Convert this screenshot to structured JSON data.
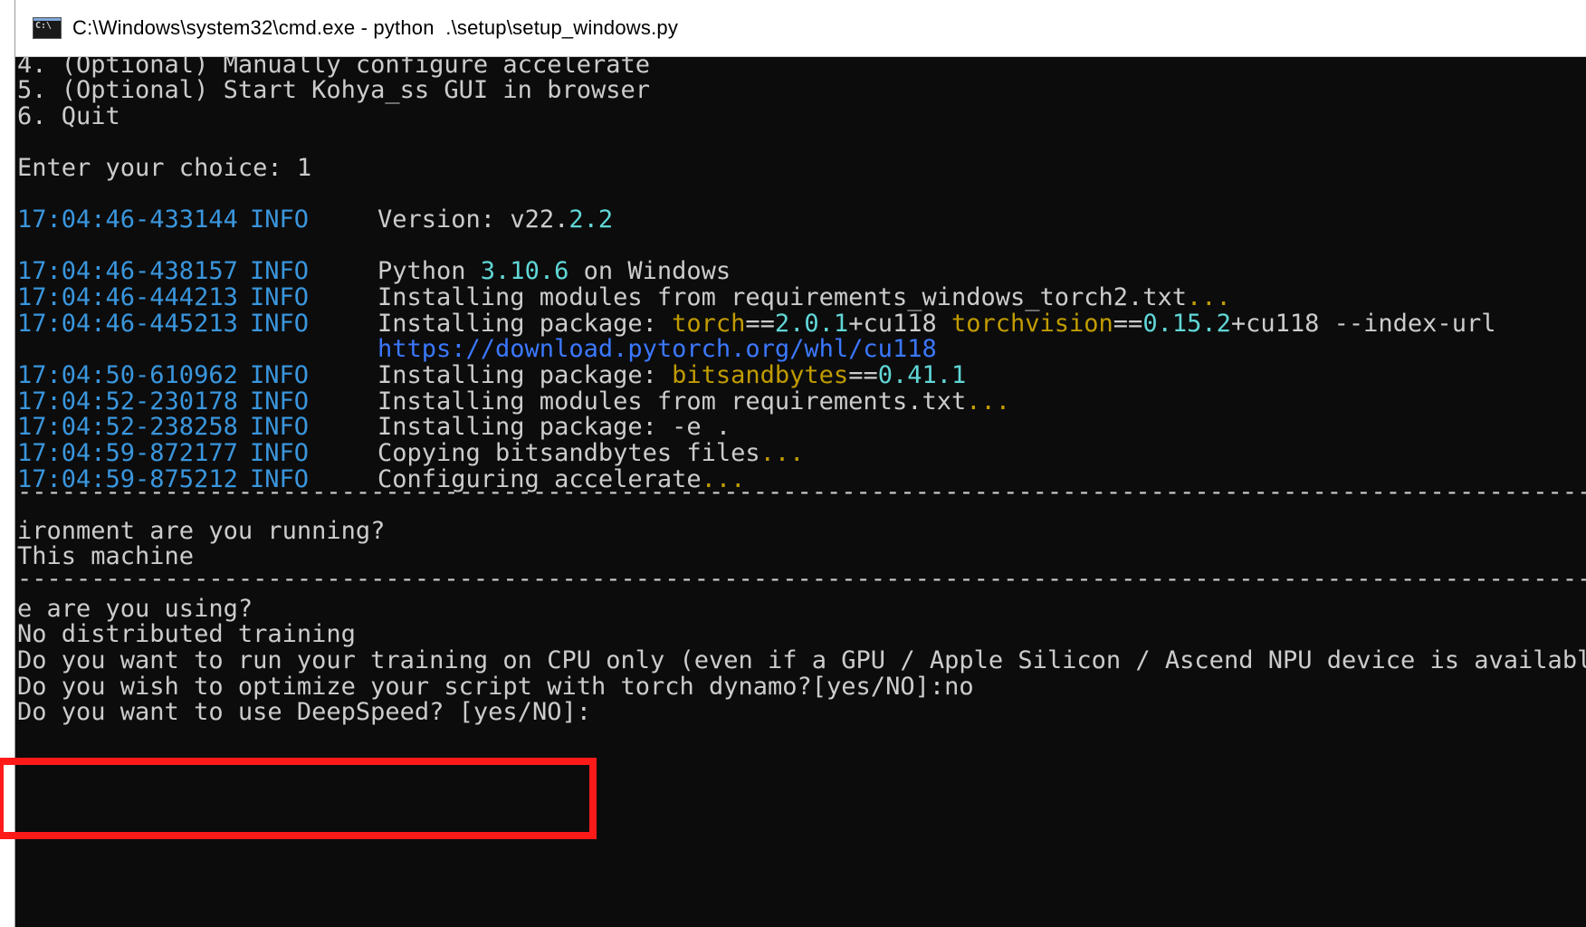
{
  "window": {
    "title": "C:\\Windows\\system32\\cmd.exe - python  .\\setup\\setup_windows.py",
    "icon": "cmd-icon"
  },
  "menu": [
    "4. (Optional) Manually configure accelerate",
    "5. (Optional) Start Kohya_ss GUI in browser",
    "6. Quit"
  ],
  "prompt": "Enter your choice: 1",
  "logs": [
    {
      "ts": "17:04:46-433144",
      "level": "INFO",
      "parts": [
        [
          "w",
          "Version: "
        ],
        [
          "w",
          "v22."
        ],
        [
          "c",
          "2.2"
        ]
      ]
    },
    {
      "ts": "17:04:46-438157",
      "level": "INFO",
      "parts": [
        [
          "w",
          "Python "
        ],
        [
          "c",
          "3.10.6"
        ],
        [
          "w",
          " on Windows"
        ]
      ]
    },
    {
      "ts": "17:04:46-444213",
      "level": "INFO",
      "parts": [
        [
          "w",
          "Installing modules from requirements_windows_torch2.txt"
        ],
        [
          "y",
          "..."
        ]
      ]
    },
    {
      "ts": "17:04:46-445213",
      "level": "INFO",
      "parts": [
        [
          "w",
          "Installing package: "
        ],
        [
          "y",
          "torch"
        ],
        [
          "w",
          "=="
        ],
        [
          "c",
          "2.0.1"
        ],
        [
          "w",
          "+cu118 "
        ],
        [
          "y",
          "torchvision"
        ],
        [
          "w",
          "=="
        ],
        [
          "c",
          "0.15.2"
        ],
        [
          "w",
          "+cu118 --index-url"
        ]
      ]
    },
    {
      "ts": "",
      "level": "",
      "parts": [
        [
          "b",
          "https://download.pytorch.org/whl/cu118"
        ]
      ]
    },
    {
      "ts": "17:04:50-610962",
      "level": "INFO",
      "parts": [
        [
          "w",
          "Installing package: "
        ],
        [
          "y",
          "bitsandbytes"
        ],
        [
          "w",
          "=="
        ],
        [
          "c",
          "0.41.1"
        ]
      ]
    },
    {
      "ts": "17:04:52-230178",
      "level": "INFO",
      "parts": [
        [
          "w",
          "Installing modules from requirements.txt"
        ],
        [
          "y",
          "..."
        ]
      ]
    },
    {
      "ts": "17:04:52-238258",
      "level": "INFO",
      "parts": [
        [
          "w",
          "Installing package: -e ."
        ]
      ]
    },
    {
      "ts": "17:04:59-872177",
      "level": "INFO",
      "parts": [
        [
          "w",
          "Copying bitsandbytes files"
        ],
        [
          "y",
          "..."
        ]
      ]
    },
    {
      "ts": "17:04:59-875212",
      "level": "INFO",
      "parts": [
        [
          "w",
          "Configuring accelerate"
        ],
        [
          "y",
          "..."
        ]
      ]
    }
  ],
  "separator": "--------------------------------------------------------------------------------------------------------------------------------------------",
  "questions": [
    "ironment are you running?",
    "This machine",
    "e are you using?",
    "No distributed training",
    "Do you want to run your training on CPU only (even if a GPU / Apple Silicon / Ascend NPU device is available)?[yes/NO]:no",
    "Do you wish to optimize your script with torch dynamo?[yes/NO]:no",
    "Do you want to use DeepSpeed? [yes/NO]: "
  ]
}
